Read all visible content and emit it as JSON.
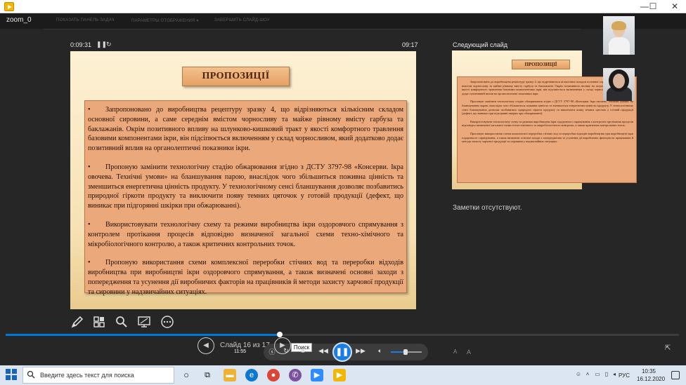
{
  "window": {
    "title": "zoom_0",
    "minimize": "—",
    "maximize": "☐",
    "close": "✕"
  },
  "toolbar": {
    "items": [
      "ПОКАЗАТЬ ПАНЕЛЬ ЗАДАЧ",
      "ПАРАМЕТРЫ ОТОБРАЖЕНИЯ ▾",
      "ЗАВЕРШИТЬ СЛАЙД-ШОУ"
    ]
  },
  "presenter": {
    "elapsed": "0:09:31",
    "pause_label": "❚❚",
    "reset_label": "↻",
    "clock": "09:17",
    "next_slide_label": "Следующий слайд",
    "notes": "Заметки отсутствуют."
  },
  "slide": {
    "title": "ПРОПОЗИЦІЇ",
    "bullet_symbol": "•",
    "paragraphs": [
      "Запропоновано до виробництва рецептуру зразку 4, що відрізняються кількісним складом основної сировини, а саме середнім вмістом чорносливу та майже рівному вмісту гарбуза та баклажанів. Окрім позитивного впливу на шлунково-кишковий тракт у якості комфортного травлення базовими компонентами ікри, він підсіпюється включенням у склад чорносливом, який додатково додає позитивний вплив на органолептичні показники ікри.",
      "Пропоную замінити технологічну стадію обжарювання згідно з ДСТУ 3797-98 «Консерви. Ікра овочева. Технічні умови» на бланшування парою, внаслідок чого збільшиться поживна цінність та зменшиться енергетична цінність продукту. У технологічному сенсі бланшування дозволяє позбавитись природної гіркоти продукту та виключити появу темних цяточок у готовій продукції (дефект, що виникає при підгорянні шкірки при обжарюванні).",
      "Використовувати технологічну схему та режими виробництва ікри оздоровчого спрямування з контролем протікання процесів відповідно визначеної загальної схеми техно-хімічного та мікробіологічного контролю, а також критичних контрольних точок.",
      "Пропоную використання схеми комплексної переробки стічних вод та переробки відходів виробництва при виробництві ікри оздоровчого спрямування, а також визначені основні заходи з попередження та усунення дії виробничих факторів на працівників й методи захисту харчової продукції та сировини у надзвичайних ситуаціях."
    ]
  },
  "next_slide": {
    "title": "ПРОПОЗИЦІЇ",
    "paragraphs": [
      "Запропоновано до виробництва рецептуру зразку 4, що відрізняються кількісним складом основної сировини, а саме середнім вмістом чорносливу та майже рівному вмісту гарбуза та баклажанів. Окрім позитивного впливу на шлунково-кишковий тракт у якості комфортного травлення базовими компонентами ікри, він підсіпюється включенням у склад чорносливом, який додатково додає позитивний вплив на органолептичні показники ікри.",
      "Пропоную замінити технологічну стадію обжарювання згідно з ДСТУ 3797-98 «Консерви. Ікра овочева. Технічні умови» на бланшування парою, внаслідок чого збільшиться поживна цінність та зменшиться енергетична цінність продукту. У технологічному сенсі бланшування дозволяє позбавитись природної гіркоти продукту та виключити появу темних цяточок у готовій продукції (дефект, що виникає при підгорянні шкірки при обжарюванні).",
      "Використовувати технологічну схему та режими виробництва ікри оздоровчого спрямування з контролем протікання процесів відповідно визначеної загальної схеми техно-хімічного та мікробіологічного контролю, а також критичних контрольних точок.",
      "Пропоную використання схеми комплексної переробки стічних вод та переробки відходів виробництва при виробництві ікри оздоровчого спрямування, а також визначені основні заходи з попередження та усунення дії виробничих факторів на працівників й методи захисту харчової продукції та сировини у надзвичайних ситуаціях."
    ]
  },
  "tools": {
    "pen_icon": "pen-icon",
    "grid_icon": "slides-grid-icon",
    "zoom_icon": "magnifier-icon",
    "screen_icon": "screen-icon",
    "more_icon": "more-icon"
  },
  "media": {
    "slide_counter": "Слайд 16 из 17",
    "time": "11:55",
    "tooltip": "Поиск",
    "progress_fraction": 0.4,
    "volume_fraction": 0.5,
    "font_smaller": "A",
    "font_larger": "A"
  },
  "taskbar": {
    "search_placeholder": "Введите здесь текст для поиска",
    "language": "РУС",
    "time": "10:35",
    "date": "16.12.2020"
  },
  "colors": {
    "accent": "#1d7ce0",
    "slide_box": "#eba87b",
    "title_box": "#e4a164"
  }
}
